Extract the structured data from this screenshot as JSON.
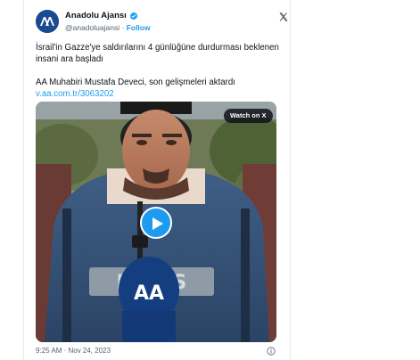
{
  "tweet": {
    "author": {
      "display_name": "Anadolu Ajansı",
      "handle": "@anadoluajansi",
      "separator": "·",
      "follow_label": "Follow"
    },
    "text_line_1": "İsrail'in Gazze'ye saldırılarını 4 günlüğüne durdurması beklenen insani ara başladı",
    "text_line_2": "AA Muhabiri Mustafa Deveci, son gelişmeleri aktardı",
    "link": "v.aa.com.tr/3063202",
    "media": {
      "watch_label": "Watch on X",
      "vest_text": "PRESS",
      "mic_logo": "AA"
    },
    "timestamp": "9:25 AM · Nov 24, 2023"
  },
  "icons": {
    "avatar": "aa-logo-avatar",
    "verified": "verified-badge-icon",
    "platform": "x-logo-icon",
    "play": "play-icon",
    "info": "info-icon"
  },
  "colors": {
    "brand_blue": "#1d9bf0",
    "text": "#0f1419",
    "muted": "#536471",
    "aa_navy": "#1a4a8f"
  }
}
